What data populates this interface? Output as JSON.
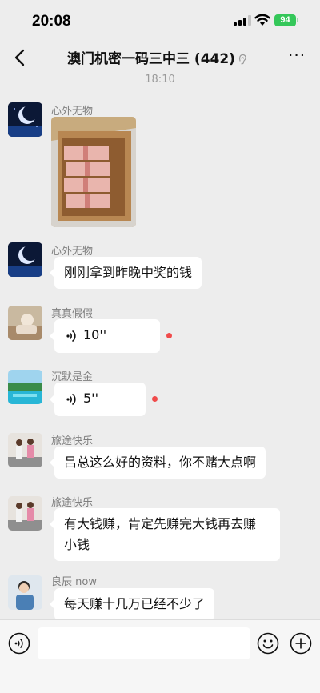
{
  "status_bar": {
    "time": "20:08",
    "battery": "94"
  },
  "nav": {
    "title": "澳门机密一码三中三 (442)"
  },
  "chat": {
    "timestamp": "18:10",
    "messages": [
      {
        "sender": "心外无物",
        "type": "image",
        "image": "cash-in-box"
      },
      {
        "sender": "心外无物",
        "type": "text",
        "text": "刚刚拿到昨晚中奖的钱"
      },
      {
        "sender": "真真假假",
        "type": "voice",
        "duration": "10''",
        "unread": true
      },
      {
        "sender": "沉默是金",
        "type": "voice",
        "duration": "5''",
        "unread": true
      },
      {
        "sender": "旅途快乐",
        "type": "text",
        "text": "吕总这么好的资料，你不赌大点啊"
      },
      {
        "sender": "旅途快乐",
        "type": "text",
        "lines": [
          "有大钱赚，肯定先赚完大钱再去赚",
          "小钱"
        ]
      },
      {
        "sender": "良辰 now",
        "type": "text",
        "text": "每天赚十几万已经不少了"
      }
    ]
  },
  "input_bar": {
    "icons": [
      "voice-icon",
      "emoji-icon",
      "plus-icon"
    ]
  },
  "colors": {
    "background": "#ededed",
    "bubble": "#ffffff",
    "unread_dot": "#f04b4b",
    "battery": "#34c759"
  }
}
